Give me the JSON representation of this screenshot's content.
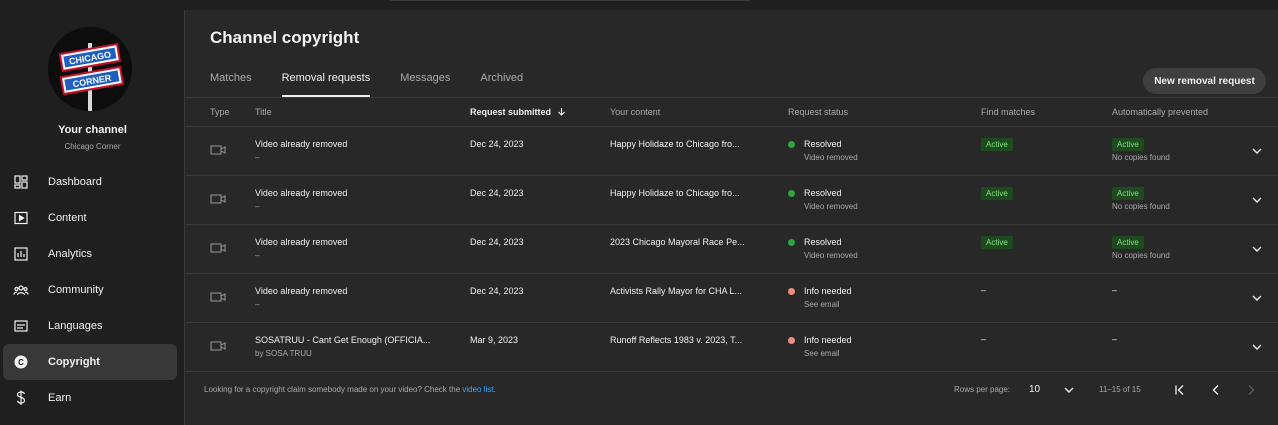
{
  "sidebar": {
    "channel_label": "Your channel",
    "channel_name": "Chicago Corner",
    "avatar_sign_top": "CHICAGO",
    "avatar_sign_bottom": "CORNER",
    "items": [
      {
        "label": "Dashboard",
        "icon": "dashboard-icon",
        "active": false
      },
      {
        "label": "Content",
        "icon": "content-icon",
        "active": false
      },
      {
        "label": "Analytics",
        "icon": "analytics-icon",
        "active": false
      },
      {
        "label": "Community",
        "icon": "community-icon",
        "active": false
      },
      {
        "label": "Languages",
        "icon": "languages-icon",
        "active": false
      },
      {
        "label": "Copyright",
        "icon": "copyright-icon",
        "active": true
      },
      {
        "label": "Earn",
        "icon": "earn-icon",
        "active": false
      }
    ]
  },
  "page": {
    "title": "Channel copyright",
    "tabs": [
      "Matches",
      "Removal requests",
      "Messages",
      "Archived"
    ],
    "active_tab": "Removal requests",
    "new_button": "New removal request"
  },
  "table": {
    "headers": {
      "type": "Type",
      "title": "Title",
      "submitted": "Request submitted",
      "content": "Your content",
      "status": "Request status",
      "find": "Find matches",
      "auto": "Automatically prevented"
    },
    "sort_icon": "arrow-down-icon",
    "rows": [
      {
        "title": "Video already removed",
        "sub": "–",
        "date": "Dec 24, 2023",
        "content": "Happy Holidaze to Chicago fro...",
        "status": "Resolved",
        "status_sub": "Video removed",
        "status_color": "#2ba640",
        "find": "Active",
        "auto": "Active",
        "auto_sub": "No copies found"
      },
      {
        "title": "Video already removed",
        "sub": "–",
        "date": "Dec 24, 2023",
        "content": "Happy Holidaze to Chicago fro...",
        "status": "Resolved",
        "status_sub": "Video removed",
        "status_color": "#2ba640",
        "find": "Active",
        "auto": "Active",
        "auto_sub": "No copies found"
      },
      {
        "title": "Video already removed",
        "sub": "–",
        "date": "Dec 24, 2023",
        "content": "2023 Chicago Mayoral Race Pe...",
        "status": "Resolved",
        "status_sub": "Video removed",
        "status_color": "#2ba640",
        "find": "Active",
        "auto": "Active",
        "auto_sub": "No copies found"
      },
      {
        "title": "Video already removed",
        "sub": "–",
        "date": "Dec 24, 2023",
        "content": "Activists Rally Mayor for CHA L...",
        "status": "Info needed",
        "status_sub": "See email",
        "status_color": "#f28b82",
        "find": "–",
        "auto": "–",
        "auto_sub": ""
      },
      {
        "title": "SOSATRUU - Cant Get Enough (OFFICIA...",
        "sub": "by SOSA TRUU",
        "date": "Mar 9, 2023",
        "content": "Runoff Reflects 1983 v. 2023, T...",
        "status": "Info needed",
        "status_sub": "See email",
        "status_color": "#f28b82",
        "find": "–",
        "auto": "–",
        "auto_sub": ""
      }
    ]
  },
  "footer": {
    "text": "Looking for a copyright claim somebody made on your video? Check the ",
    "link": "video list",
    "text_end": ".",
    "rows_per_page_label": "Rows per page:",
    "rows_per_page": "10",
    "range": "11–15 of 15"
  }
}
